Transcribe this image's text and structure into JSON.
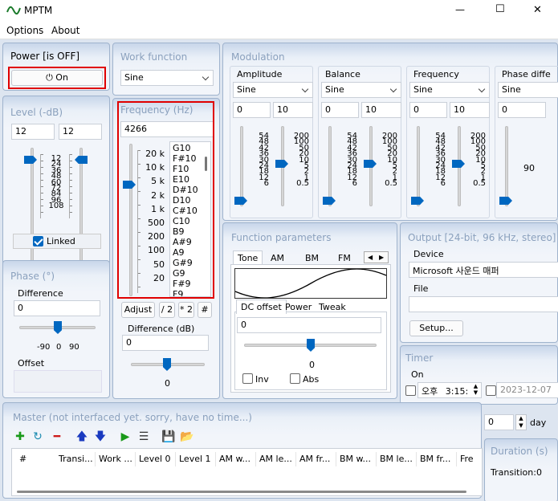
{
  "window": {
    "title": "MPTM",
    "minimize_glyph": "—",
    "maximize_glyph": "☐",
    "close_glyph": "✕"
  },
  "menu": {
    "items": [
      "Options",
      "About"
    ]
  },
  "power": {
    "title": "Power [is OFF]",
    "button_label": "On",
    "button_icon": "power-icon"
  },
  "level": {
    "title": "Level (-dB)",
    "left_value": "12",
    "right_value": "12",
    "scale": [
      "12",
      "24",
      "36",
      "48",
      "60",
      "72",
      "84",
      "96",
      "108"
    ],
    "linked_label": "Linked",
    "linked_checked": true
  },
  "phase": {
    "title": "Phase (°)",
    "difference_label": "Difference",
    "difference_value": "0",
    "scale": [
      "-90",
      "0",
      "90"
    ],
    "offset_label": "Offset"
  },
  "work_function": {
    "title": "Work function",
    "value": "Sine"
  },
  "frequency": {
    "title": "Frequency (Hz)",
    "value": "4266",
    "scale": [
      "20 k",
      "10 k",
      "5 k",
      "2 k",
      "1 k",
      "500",
      "200",
      "100",
      "50",
      "20"
    ],
    "notes": [
      "G10",
      "F#10",
      "F10",
      "E10",
      "D#10",
      "D10",
      "C#10",
      "C10",
      "B9",
      "A#9",
      "A9",
      "G#9",
      "G9",
      "F#9",
      "F9"
    ],
    "adjust_label": "Adjust",
    "div2_label": "/ 2",
    "mul2_label": "* 2",
    "hash_label": "#",
    "difference_label": "Difference (dB)",
    "difference_value": "0",
    "difference_slider_value": "0"
  },
  "modulation": {
    "title": "Modulation",
    "groups": [
      {
        "title": "Amplitude",
        "type": "Sine",
        "min": "0",
        "max": "10",
        "left_scale": [
          "54",
          "48",
          "42",
          "36",
          "30",
          "24",
          "18",
          "12",
          "6"
        ],
        "right_scale": [
          "200",
          "100",
          "50",
          "20",
          "10",
          "5",
          "2",
          "1",
          "0.5"
        ]
      },
      {
        "title": "Balance",
        "type": "Sine",
        "min": "0",
        "max": "10",
        "left_scale": [
          "54",
          "48",
          "42",
          "36",
          "30",
          "24",
          "18",
          "12",
          "6"
        ],
        "right_scale": [
          "200",
          "100",
          "50",
          "20",
          "10",
          "5",
          "2",
          "1",
          "0.5"
        ]
      },
      {
        "title": "Frequency",
        "type": "Sine",
        "min": "0",
        "max": "10",
        "left_scale": [
          "54",
          "48",
          "42",
          "36",
          "30",
          "24",
          "18",
          "12",
          "6"
        ],
        "right_scale": [
          "200",
          "100",
          "50",
          "20",
          "10",
          "5",
          "2",
          "1",
          "0.5"
        ]
      },
      {
        "title": "Phase diffe",
        "type": "Sine",
        "min": "0",
        "max": "",
        "right_value": "90"
      }
    ]
  },
  "function_params": {
    "title": "Function parameters",
    "tabs": [
      "Tone",
      "AM",
      "BM",
      "FM"
    ],
    "subtabs": [
      "DC offset",
      "Power",
      "Tweak"
    ],
    "dc_value": "0",
    "slider_value": "0",
    "inv_label": "Inv",
    "abs_label": "Abs"
  },
  "output": {
    "title": "Output [24-bit, 96 kHz, stereo]",
    "device_label": "Device",
    "device_value": "Microsoft 사운드 매퍼",
    "file_label": "File",
    "file_value": "",
    "setup_label": "Setup..."
  },
  "timer": {
    "title": "Timer",
    "on_label": "On",
    "ampm": "오후",
    "time": "3:15:",
    "date": "2023-12-07",
    "days_value": "0",
    "days_label": "day"
  },
  "duration": {
    "title": "Duration (s)",
    "transition_label": "Transition:",
    "transition_value": "0"
  },
  "master": {
    "title": "Master (not interfaced yet. sorry, have no time...)",
    "columns": [
      "#",
      "Transi...",
      "Work ...",
      "Level 0",
      "Level 1",
      "AM w...",
      "AM le...",
      "AM fr...",
      "BM w...",
      "BM le...",
      "BM fr...",
      "Fre"
    ]
  }
}
